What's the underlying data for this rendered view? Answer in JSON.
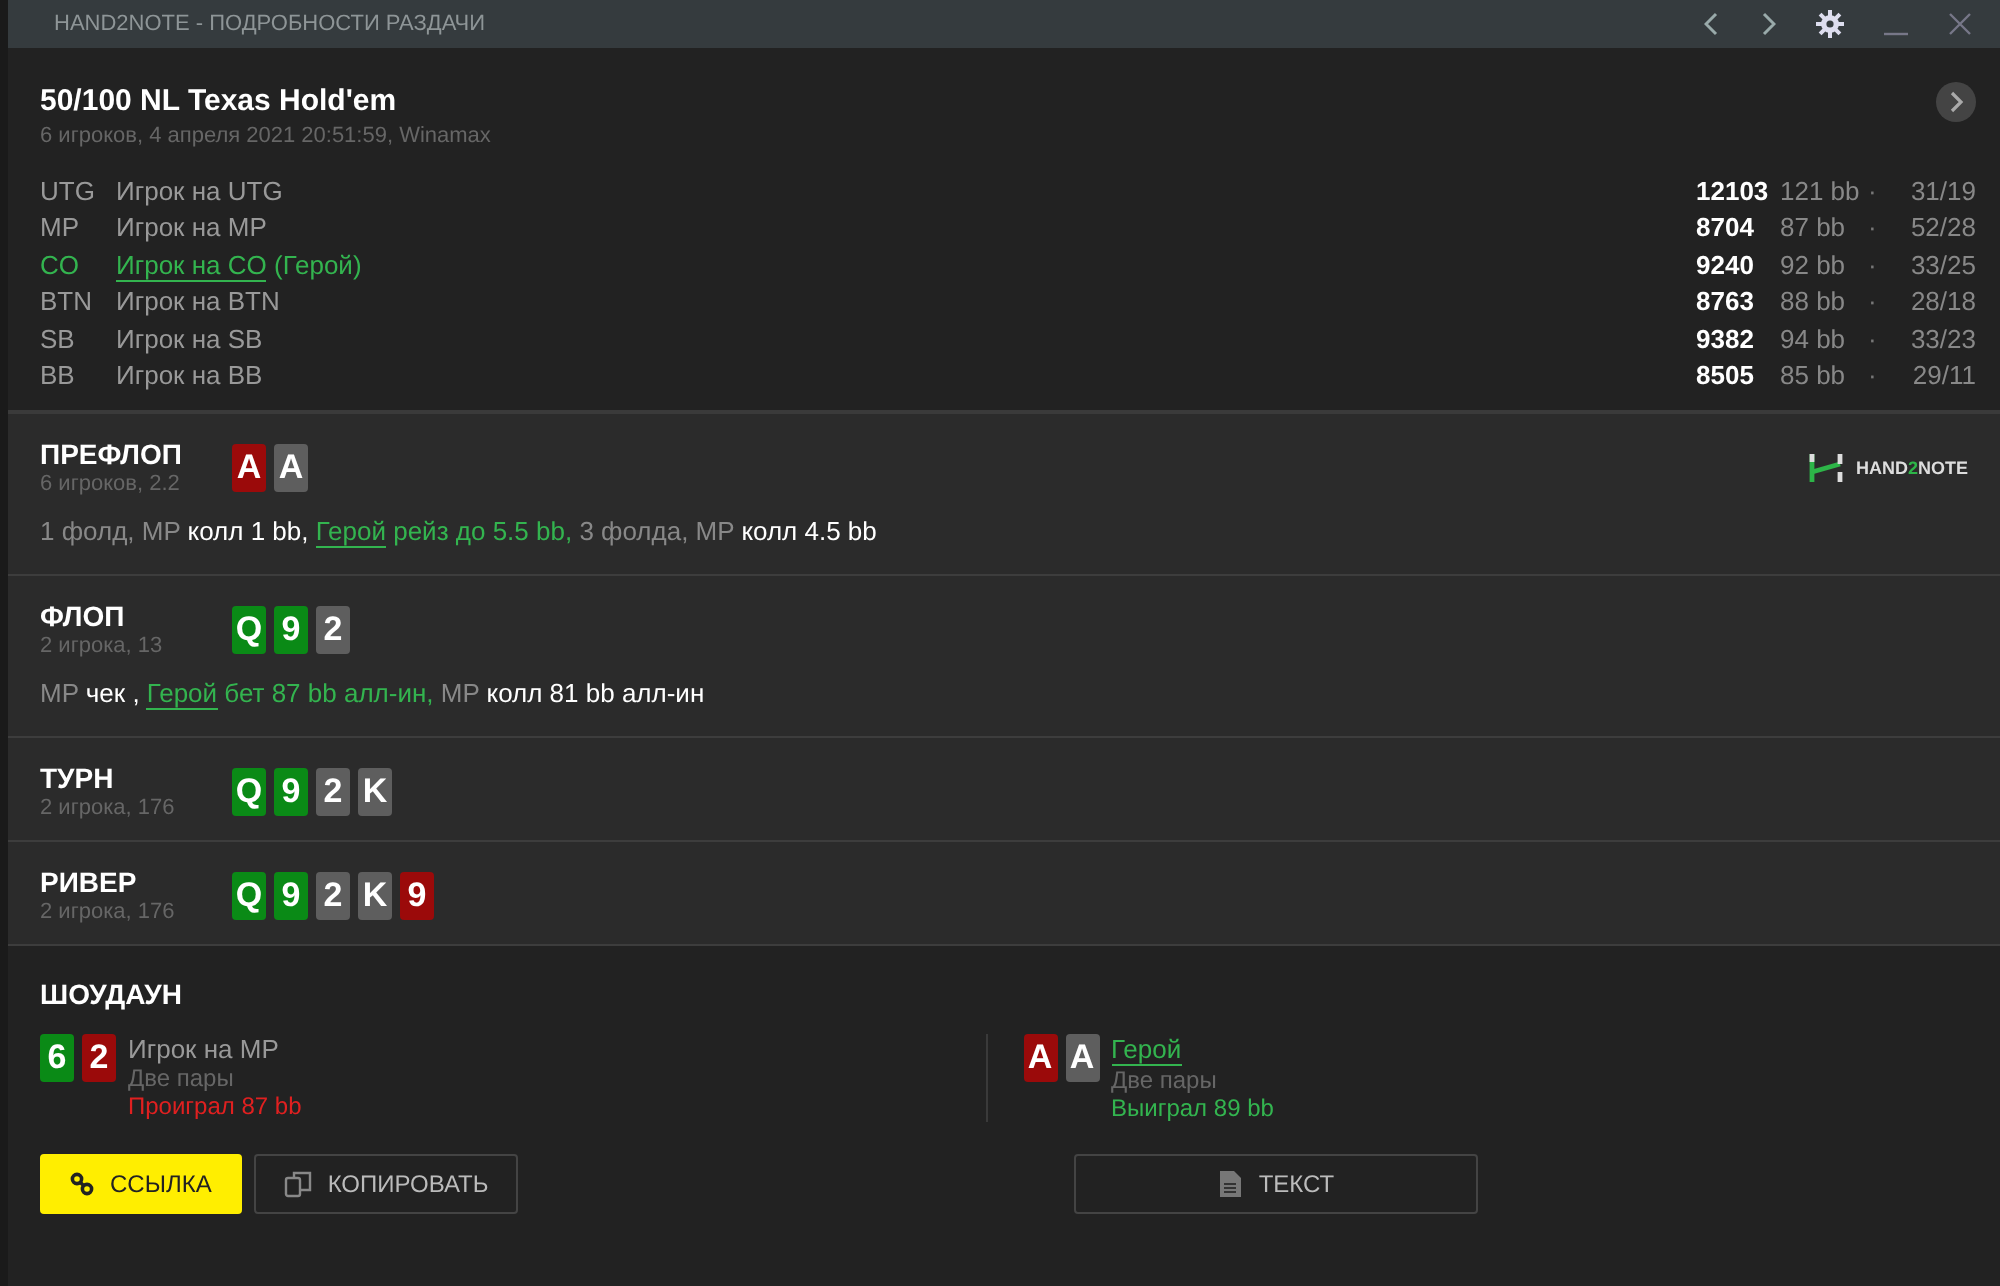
{
  "window": {
    "title": "HAND2NOTE - ПОДРОБНОСТИ РАЗДАЧИ"
  },
  "hand": {
    "title": "50/100 NL Texas Hold'em",
    "subtitle": "6 игроков, 4 апреля 2021 20:51:59, Winamax"
  },
  "players": [
    {
      "position": "UTG",
      "name": "Игрок на UTG",
      "hero": false,
      "stack": "12103",
      "bb": "121 bb",
      "dot": "·",
      "stats": "31/19"
    },
    {
      "position": "MP",
      "name": "Игрок на MP",
      "hero": false,
      "stack": "8704",
      "bb": "87 bb",
      "dot": "·",
      "stats": "52/28"
    },
    {
      "position": "CO",
      "name": "Игрок на CO",
      "tag": "(Герой)",
      "hero": true,
      "stack": "9240",
      "bb": "92 bb",
      "dot": "·",
      "stats": "33/25"
    },
    {
      "position": "BTN",
      "name": "Игрок на BTN",
      "hero": false,
      "stack": "8763",
      "bb": "88 bb",
      "dot": "·",
      "stats": "28/18"
    },
    {
      "position": "SB",
      "name": "Игрок на SB",
      "hero": false,
      "stack": "9382",
      "bb": "94 bb",
      "dot": "·",
      "stats": "33/23"
    },
    {
      "position": "BB",
      "name": "Игрок на BB",
      "hero": false,
      "stack": "8505",
      "bb": "85 bb",
      "dot": "·",
      "stats": "29/11"
    }
  ],
  "streets": [
    {
      "name": "ПРЕФЛОП",
      "info": "6 игроков, 2.2",
      "cards": [
        {
          "rank": "A",
          "color": "#9b0a0a"
        },
        {
          "rank": "A",
          "color": "#5e5e5e"
        }
      ],
      "logo": {
        "pre": "HAND",
        "mid": "2",
        "post": "NOTE"
      },
      "actions": [
        {
          "kind": "muted",
          "text": "1 фолд, MP "
        },
        {
          "kind": "action",
          "text": "колл 1 bb, "
        },
        {
          "kind": "hero-link",
          "text": "Герой"
        },
        {
          "kind": "hero",
          "text": " рейз до 5.5 bb,"
        },
        {
          "kind": "muted",
          "text": " 3 фолда, MP "
        },
        {
          "kind": "action",
          "text": "колл 4.5 bb"
        }
      ]
    },
    {
      "name": "ФЛОП",
      "info": "2 игрока, 13",
      "cards": [
        {
          "rank": "Q",
          "color": "#0a8a16"
        },
        {
          "rank": "9",
          "color": "#0a8a16"
        },
        {
          "rank": "2",
          "color": "#5e5e5e"
        }
      ],
      "actions": [
        {
          "kind": "muted",
          "text": "MP "
        },
        {
          "kind": "action",
          "text": "чек , "
        },
        {
          "kind": "hero-link",
          "text": "Герой"
        },
        {
          "kind": "hero",
          "text": " бет 87 bb алл-ин,"
        },
        {
          "kind": "muted",
          "text": " MP "
        },
        {
          "kind": "action",
          "text": "колл 81 bb алл-ин"
        }
      ]
    },
    {
      "name": "ТУРН",
      "info": "2 игрока, 176",
      "cards": [
        {
          "rank": "Q",
          "color": "#0a8a16"
        },
        {
          "rank": "9",
          "color": "#0a8a16"
        },
        {
          "rank": "2",
          "color": "#5e5e5e"
        },
        {
          "rank": "K",
          "color": "#5e5e5e"
        }
      ]
    },
    {
      "name": "РИВЕР",
      "info": "2 игрока, 176",
      "cards": [
        {
          "rank": "Q",
          "color": "#0a8a16"
        },
        {
          "rank": "9",
          "color": "#0a8a16"
        },
        {
          "rank": "2",
          "color": "#5e5e5e"
        },
        {
          "rank": "K",
          "color": "#5e5e5e"
        },
        {
          "rank": "9",
          "color": "#9b0a0a"
        }
      ]
    }
  ],
  "showdown": {
    "title": "ШОУДАУН",
    "players": [
      {
        "name": "Игрок на MP",
        "hero": false,
        "hand": "Две пары",
        "result": "Проиграл 87 bb",
        "won": false,
        "cards": [
          {
            "rank": "6",
            "color": "#0a8a16"
          },
          {
            "rank": "2",
            "color": "#9b0a0a"
          }
        ]
      },
      {
        "name": "Герой",
        "hero": true,
        "hand": "Две пары",
        "result": "Выиграл 89 bb",
        "won": true,
        "cards": [
          {
            "rank": "A",
            "color": "#9b0a0a"
          },
          {
            "rank": "A",
            "color": "#5e5e5e"
          }
        ]
      }
    ]
  },
  "buttons": [
    {
      "label": "ССЫЛКА",
      "kind": "link",
      "primary": true
    },
    {
      "label": "КОПИРОВАТЬ",
      "kind": "copy",
      "primary": false
    },
    {
      "label": "ТЕКСТ",
      "kind": "text",
      "primary": false
    }
  ]
}
